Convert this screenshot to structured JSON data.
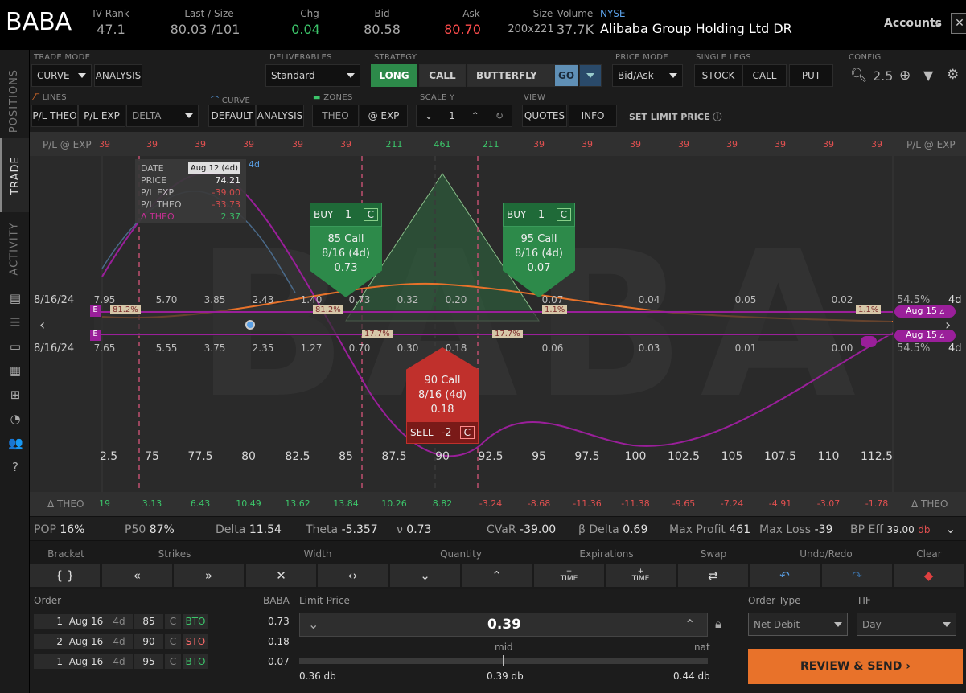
{
  "header": {
    "symbol": "BABA",
    "iv_rank_label": "IV Rank",
    "iv_rank": "47.1",
    "last_size_label": "Last / Size",
    "last_size": "80.03 /101",
    "chg_label": "Chg",
    "chg": "0.04",
    "bid_label": "Bid",
    "bid": "80.58",
    "ask_label": "Ask",
    "ask": "80.70",
    "size_label": "Size",
    "size": "200x221",
    "volume_label": "Volume",
    "volume": "37.7K",
    "exchange": "NYSE",
    "company": "Alibaba Group Holding Ltd DR",
    "accounts": "Accounts"
  },
  "rail": {
    "tabs": [
      "POSITIONS",
      "TRADE",
      "ACTIVITY"
    ]
  },
  "toolbar": {
    "trade_mode_label": "TRADE MODE",
    "trade_mode": "CURVE",
    "analysis": "ANALYSIS",
    "deliverables_label": "DELIVERABLES",
    "deliverables": "Standard",
    "strategy_label": "STRATEGY",
    "long": "LONG",
    "call": "CALL",
    "butterfly": "BUTTERFLY",
    "go": "GO",
    "price_mode_label": "PRICE MODE",
    "price_mode": "Bid/Ask",
    "single_legs_label": "SINGLE LEGS",
    "stock": "STOCK",
    "call_leg": "CALL",
    "put_leg": "PUT",
    "config_label": "CONFIG",
    "zoom": "2.5",
    "lines_label": "LINES",
    "pl_theo": "P/L THEO",
    "pl_exp": "P/L EXP",
    "delta": "DELTA",
    "curve_label": "CURVE",
    "default": "DEFAULT",
    "curve_analysis": "ANALYSIS",
    "zones_label": "ZONES",
    "theo": "THEO",
    "at_exp": "@ EXP",
    "scale_label": "SCALE Y",
    "scale": "1",
    "view_label": "VIEW",
    "quotes": "QUOTES",
    "info": "INFO",
    "set_limit": "SET LIMIT PRICE"
  },
  "chart": {
    "watermark": "BABA",
    "pl_row_label": "P/L @ EXP",
    "pl_values": [
      "39",
      "39",
      "39",
      "39",
      "39",
      "39",
      "211",
      "461",
      "211",
      "39",
      "39",
      "39",
      "39",
      "39",
      "39",
      "39",
      "39"
    ],
    "theo_row_label": "Δ THEO",
    "theo_values": [
      "19",
      "3.13",
      "6.43",
      "10.49",
      "13.62",
      "13.84",
      "10.26",
      "8.82",
      "-3.24",
      "-8.68",
      "-11.36",
      "-11.38",
      "-9.65",
      "-7.24",
      "-4.91",
      "-3.07",
      "-1.78"
    ],
    "date_top": "8/16/24",
    "date_bottom": "8/16/24",
    "iv_top": "54.5%",
    "iv_bottom": "54.5%",
    "days_top": "4d",
    "days_bottom": "4d",
    "strikes": [
      "2.5",
      "75",
      "77.5",
      "80",
      "82.5",
      "85",
      "87.5",
      "90",
      "92.5",
      "95",
      "97.5",
      "100",
      "102.5",
      "105",
      "107.5",
      "110",
      "112.5"
    ],
    "call_prem": [
      "7.95",
      "5.70",
      "3.85",
      "2.43",
      "1.40",
      "0.73",
      "0.32",
      "0.20",
      "0.07",
      "0.04",
      "0.05",
      "0.02"
    ],
    "put_prem": [
      "7.65",
      "5.55",
      "3.75",
      "2.35",
      "1.27",
      "0.70",
      "0.30",
      "0.18",
      "0.06",
      "0.03",
      "0.01",
      "0.00"
    ],
    "prob_top": [
      "81.2%",
      "81.2%",
      "1.1%",
      "1.1%"
    ],
    "prob_bottom": [
      "17.7%",
      "17.7%"
    ],
    "exp_label_top": "Aug 15",
    "exp_label_bottom": "Aug 15",
    "e_label": "E",
    "tooltip": {
      "date_label": "DATE",
      "date": "Aug 12 (4d)",
      "price_label": "PRICE",
      "price": "74.21",
      "plexp_label": "P/L EXP",
      "plexp": "-39.00",
      "pltheo_label": "P/L THEO",
      "pltheo": "-33.73",
      "dtheo_label": "Δ THEO",
      "dtheo": "2.37",
      "tag": "4d"
    },
    "legs": [
      {
        "side": "BUY",
        "qty": "1",
        "type": "C",
        "strike": "85 Call",
        "exp": "8/16 (4d)",
        "price": "0.73"
      },
      {
        "side": "BUY",
        "qty": "1",
        "type": "C",
        "strike": "95 Call",
        "exp": "8/16 (4d)",
        "price": "0.07"
      },
      {
        "side": "SELL",
        "qty": "-2",
        "type": "C",
        "strike": "90 Call",
        "exp": "8/16 (4d)",
        "price": "0.18"
      }
    ]
  },
  "stats": {
    "pop_label": "POP",
    "pop": "16%",
    "p50_label": "P50",
    "p50": "87%",
    "delta_label": "Delta",
    "delta": "11.54",
    "theta_label": "Theta",
    "theta": "-5.357",
    "vega_label": "ν",
    "vega": "0.73",
    "cvar_label": "CVaR",
    "cvar": "-39.00",
    "bdelta_label": "β Delta",
    "bdelta": "0.69",
    "maxp_label": "Max Profit",
    "maxp": "461",
    "maxl_label": "Max Loss",
    "maxl": "-39",
    "bp_label": "BP Eff",
    "bp": "39.00",
    "bp_unit": "db"
  },
  "controls": {
    "bracket": "Bracket",
    "strikes": "Strikes",
    "width": "Width",
    "quantity": "Quantity",
    "expirations": "Expirations",
    "swap": "Swap",
    "undo_redo": "Undo/Redo",
    "clear": "Clear",
    "time": "TIME",
    "bracket_glyph": "{ }"
  },
  "order": {
    "order_label": "Order",
    "sym_label": "BABA",
    "legs": [
      {
        "qty": "1",
        "exp": "Aug 16",
        "dte": "4d",
        "strike": "85",
        "type": "C",
        "action": "BTO",
        "price": "0.73"
      },
      {
        "qty": "-2",
        "exp": "Aug 16",
        "dte": "4d",
        "strike": "90",
        "type": "C",
        "action": "STO",
        "price": "0.18"
      },
      {
        "qty": "1",
        "exp": "Aug 16",
        "dte": "4d",
        "strike": "95",
        "type": "C",
        "action": "BTO",
        "price": "0.07"
      }
    ],
    "limit_label": "Limit Price",
    "limit": "0.39",
    "mid_label": "mid",
    "nat_label": "nat",
    "low": "0.36 db",
    "mid": "0.39 db",
    "high": "0.44 db",
    "order_type_label": "Order Type",
    "order_type": "Net Debit",
    "tif_label": "TIF",
    "tif": "Day",
    "review": "REVIEW & SEND"
  },
  "colors": {
    "green": "#2d8a4a",
    "red": "#c0302c",
    "orange": "#e8722a",
    "purple": "#9a1f9a",
    "blue": "#3e88c8"
  }
}
